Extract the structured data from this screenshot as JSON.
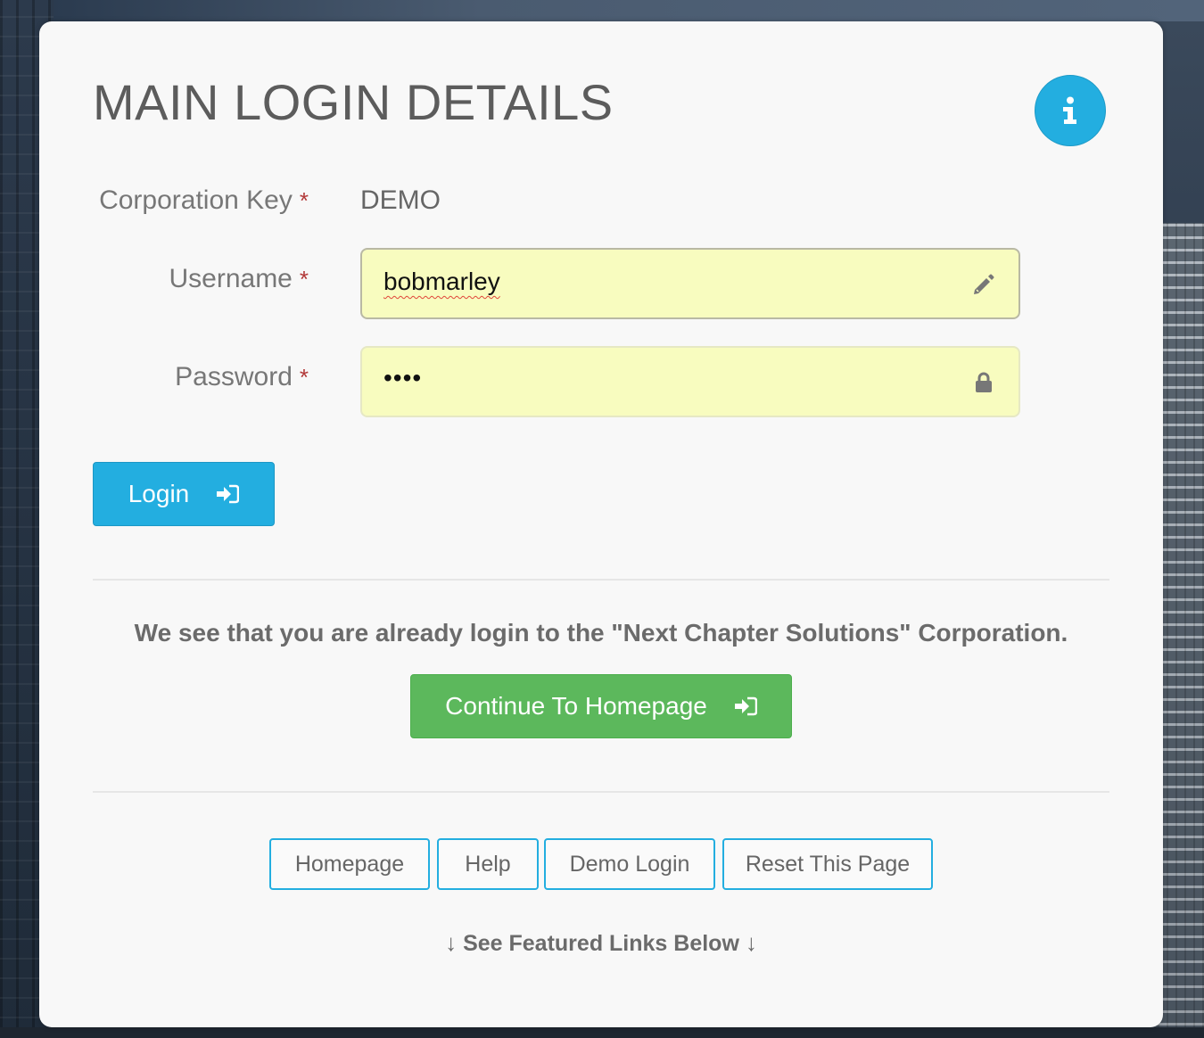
{
  "page": {
    "title": "MAIN LOGIN DETAILS"
  },
  "form": {
    "corporation_key": {
      "label": "Corporation Key",
      "required_mark": "*",
      "value": "DEMO"
    },
    "username": {
      "label": "Username",
      "required_mark": "*",
      "value": "bobmarley"
    },
    "password": {
      "label": "Password",
      "required_mark": "*",
      "masked_value": "••••"
    },
    "login_button": "Login"
  },
  "notice": {
    "text": "We see that you are already login to the \"Next Chapter Solutions\" Corporation.",
    "continue_button": "Continue To Homepage"
  },
  "links": [
    {
      "label": "Homepage"
    },
    {
      "label": "Help"
    },
    {
      "label": "Demo Login"
    },
    {
      "label": "Reset This Page"
    }
  ],
  "featured": {
    "text": "See Featured Links Below",
    "arrow": "↓"
  },
  "colors": {
    "primary": "#23aee0",
    "success": "#5cb85c",
    "required": "#b23838",
    "input_bg": "#f8fcbf"
  },
  "icons": {
    "info": "info-icon",
    "username_field": "pencil-icon",
    "password_field": "lock-icon",
    "login": "sign-in-icon"
  }
}
